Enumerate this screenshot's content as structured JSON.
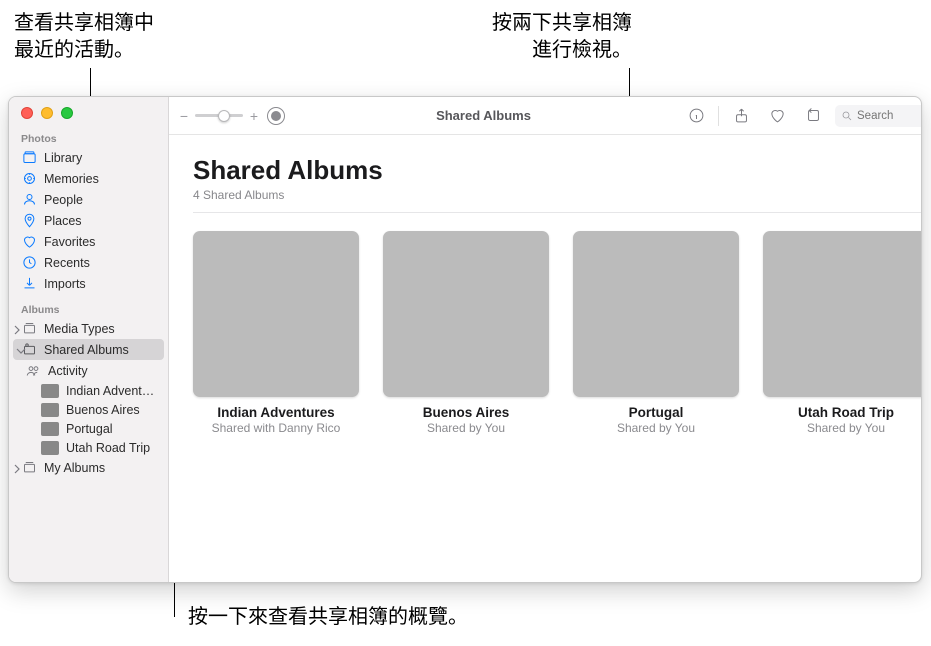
{
  "callouts": {
    "top_left_l1": "查看共享相簿中",
    "top_left_l2": "最近的活動。",
    "top_right_l1": "按兩下共享相簿",
    "top_right_l2": "進行檢視。",
    "bottom": "按一下來查看共享相簿的概覽。"
  },
  "sidebar": {
    "heading_photos": "Photos",
    "library": "Library",
    "memories": "Memories",
    "people": "People",
    "places": "Places",
    "favorites": "Favorites",
    "recents": "Recents",
    "imports": "Imports",
    "heading_albums": "Albums",
    "media_types": "Media Types",
    "shared_albums": "Shared Albums",
    "activity": "Activity",
    "sa1": "Indian Advent…",
    "sa2": "Buenos Aires",
    "sa3": "Portugal",
    "sa4": "Utah Road Trip",
    "my_albums": "My Albums"
  },
  "toolbar": {
    "title": "Shared Albums",
    "search_placeholder": "Search"
  },
  "main": {
    "title": "Shared Albums",
    "subtitle": "4 Shared Albums"
  },
  "albums": [
    {
      "name": "Indian Adventures",
      "meta": "Shared with Danny Rico"
    },
    {
      "name": "Buenos Aires",
      "meta": "Shared by You"
    },
    {
      "name": "Portugal",
      "meta": "Shared by You"
    },
    {
      "name": "Utah Road Trip",
      "meta": "Shared by You"
    }
  ]
}
